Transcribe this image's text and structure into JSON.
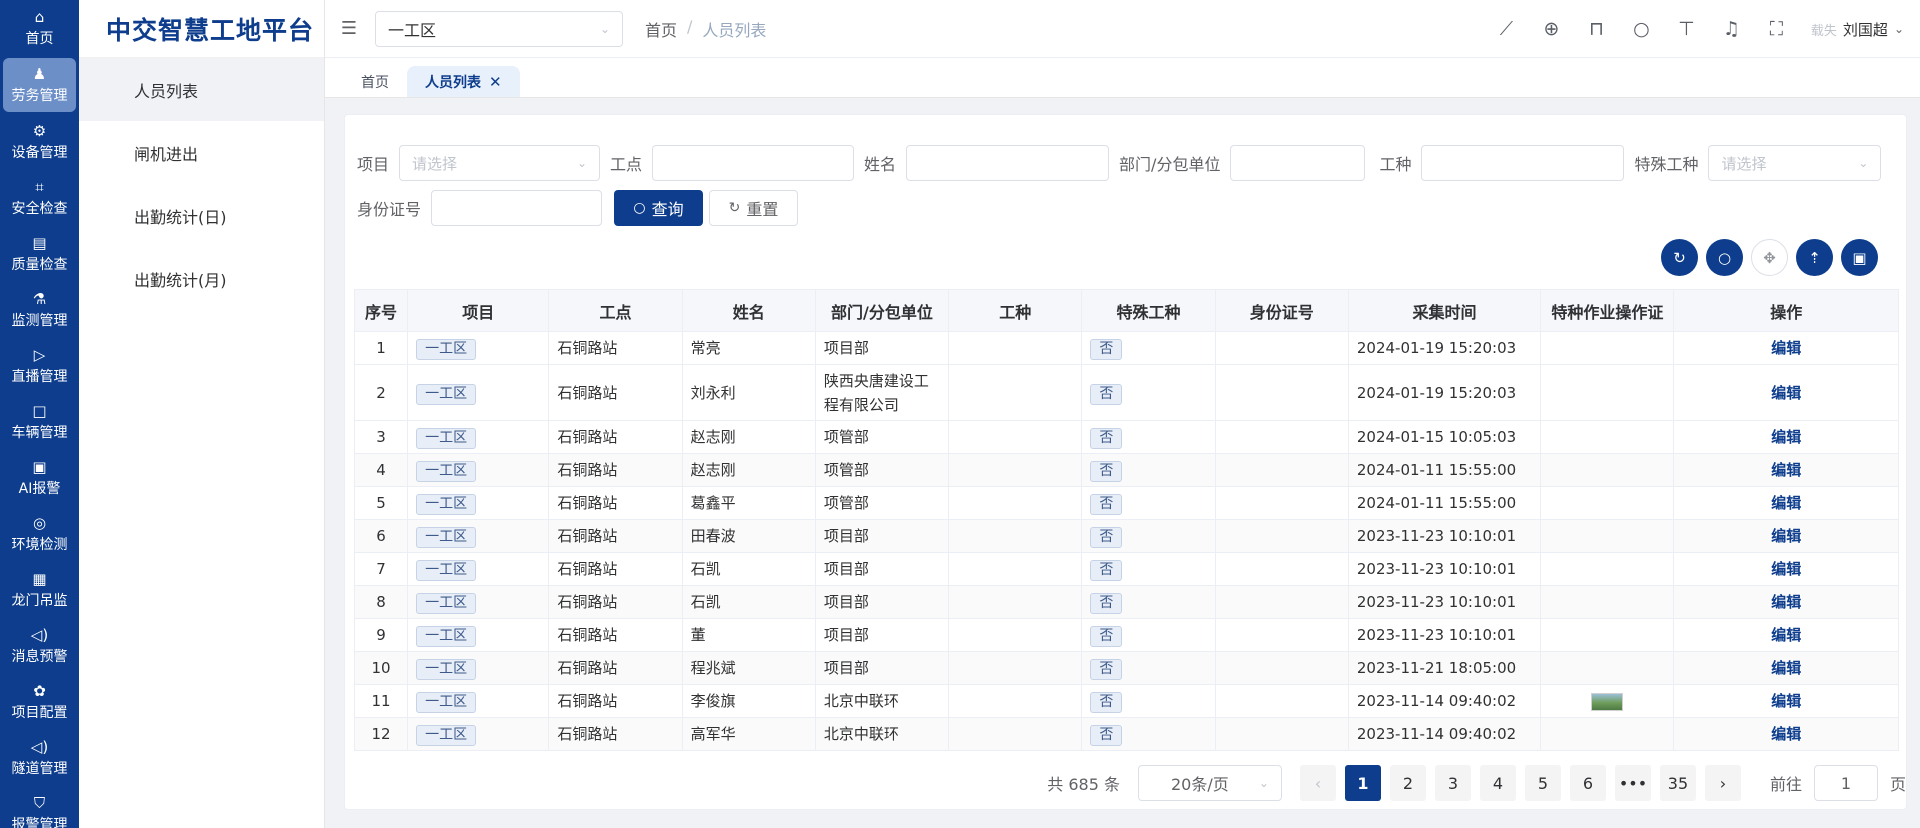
{
  "rail": {
    "items": [
      {
        "label": "首页",
        "icon": "⌂"
      },
      {
        "label": "劳务管理",
        "icon": "♟"
      },
      {
        "label": "设备管理",
        "icon": "⚙"
      },
      {
        "label": "安全检查",
        "icon": "⌗"
      },
      {
        "label": "质量检查",
        "icon": "▤"
      },
      {
        "label": "监测管理",
        "icon": "⚗"
      },
      {
        "label": "直播管理",
        "icon": "▷"
      },
      {
        "label": "车辆管理",
        "icon": "□"
      },
      {
        "label": "AI报警",
        "icon": "▣"
      },
      {
        "label": "环境检测",
        "icon": "◎"
      },
      {
        "label": "龙门吊监",
        "icon": "▦"
      },
      {
        "label": "消息预警",
        "icon": "◁)"
      },
      {
        "label": "项目配置",
        "icon": "✿"
      },
      {
        "label": "隧道管理",
        "icon": "◁)"
      },
      {
        "label": "报警管理",
        "icon": "⛉"
      }
    ]
  },
  "brand": "中交智慧工地平台",
  "submenu": {
    "items": [
      "人员列表",
      "闸机进出",
      "出勤统计(日)",
      "出勤统计(月)"
    ]
  },
  "header": {
    "project": "一工区",
    "breadcrumb": [
      "首页",
      "/",
      "人员列表"
    ],
    "avatar_text": "载失",
    "username": "刘国超"
  },
  "tags": [
    "首页",
    "人员列表"
  ],
  "filters": {
    "project_label": "项目",
    "project_placeholder": "请选择",
    "site_label": "工点",
    "name_label": "姓名",
    "dept_label": "部门/分包单位",
    "worktype_label": "工种",
    "special_label": "特殊工种",
    "special_placeholder": "请选择",
    "id_label": "身份证号",
    "search_btn": "查询",
    "reset_btn": "重置"
  },
  "table": {
    "columns": [
      "序号",
      "项目",
      "工点",
      "姓名",
      "部门/分包单位",
      "工种",
      "特殊工种",
      "身份证号",
      "采集时间",
      "特种作业操作证",
      "操作"
    ],
    "rows": [
      {
        "no": "1",
        "project": "一工区",
        "site": "石铜路站",
        "name": "常亮",
        "dept": "项目部",
        "worktype": "",
        "special": "否",
        "idno": "",
        "time": "2024-01-19 15:20:03",
        "cert": "",
        "op": "编辑"
      },
      {
        "no": "2",
        "project": "一工区",
        "site": "石铜路站",
        "name": "刘永利",
        "dept": "陕西央唐建设工程有限公司",
        "worktype": "",
        "special": "否",
        "idno": "",
        "time": "2024-01-19 15:20:03",
        "cert": "",
        "op": "编辑"
      },
      {
        "no": "3",
        "project": "一工区",
        "site": "石铜路站",
        "name": "赵志刚",
        "dept": "项管部",
        "worktype": "",
        "special": "否",
        "idno": "",
        "time": "2024-01-15 10:05:03",
        "cert": "",
        "op": "编辑"
      },
      {
        "no": "4",
        "project": "一工区",
        "site": "石铜路站",
        "name": "赵志刚",
        "dept": "项管部",
        "worktype": "",
        "special": "否",
        "idno": "",
        "time": "2024-01-11 15:55:00",
        "cert": "",
        "op": "编辑"
      },
      {
        "no": "5",
        "project": "一工区",
        "site": "石铜路站",
        "name": "葛鑫平",
        "dept": "项管部",
        "worktype": "",
        "special": "否",
        "idno": "",
        "time": "2024-01-11 15:55:00",
        "cert": "",
        "op": "编辑"
      },
      {
        "no": "6",
        "project": "一工区",
        "site": "石铜路站",
        "name": "田春波",
        "dept": "项目部",
        "worktype": "",
        "special": "否",
        "idno": "",
        "time": "2023-11-23 10:10:01",
        "cert": "",
        "op": "编辑"
      },
      {
        "no": "7",
        "project": "一工区",
        "site": "石铜路站",
        "name": "石凯",
        "dept": "项目部",
        "worktype": "",
        "special": "否",
        "idno": "",
        "time": "2023-11-23 10:10:01",
        "cert": "",
        "op": "编辑"
      },
      {
        "no": "8",
        "project": "一工区",
        "site": "石铜路站",
        "name": "石凯",
        "dept": "项目部",
        "worktype": "",
        "special": "否",
        "idno": "",
        "time": "2023-11-23 10:10:01",
        "cert": "",
        "op": "编辑"
      },
      {
        "no": "9",
        "project": "一工区",
        "site": "石铜路站",
        "name": "董",
        "dept": "项目部",
        "worktype": "",
        "special": "否",
        "idno": "",
        "time": "2023-11-23 10:10:01",
        "cert": "",
        "op": "编辑"
      },
      {
        "no": "10",
        "project": "一工区",
        "site": "石铜路站",
        "name": "程兆斌",
        "dept": "项目部",
        "worktype": "",
        "special": "否",
        "idno": "",
        "time": "2023-11-21 18:05:00",
        "cert": "",
        "op": "编辑"
      },
      {
        "no": "11",
        "project": "一工区",
        "site": "石铜路站",
        "name": "李俊旗",
        "dept": "北京中联环",
        "worktype": "",
        "special": "否",
        "idno": "",
        "time": "2023-11-14 09:40:02",
        "cert": "image",
        "op": "编辑"
      },
      {
        "no": "12",
        "project": "一工区",
        "site": "石铜路站",
        "name": "高军华",
        "dept": "北京中联环",
        "worktype": "",
        "special": "否",
        "idno": "",
        "time": "2023-11-14 09:40:02",
        "cert": "",
        "op": "编辑"
      }
    ]
  },
  "pagination": {
    "total": "共 685 条",
    "page_size": "20条/页",
    "pages": [
      "1",
      "2",
      "3",
      "4",
      "5",
      "6",
      "•••",
      "35"
    ],
    "current": "1",
    "goto_label": "前往",
    "goto_value": "1",
    "page_suffix": "页"
  },
  "colors": {
    "primary": "#0d3d8c",
    "rail_active": "#6c8fc7"
  }
}
